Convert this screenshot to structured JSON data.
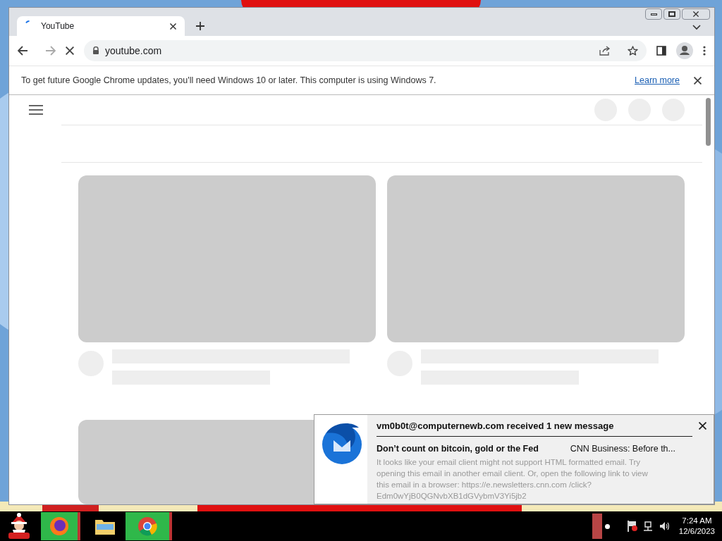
{
  "browser": {
    "tabs": [
      {
        "title": "YouTube",
        "selected": true
      }
    ],
    "address": "youtube.com",
    "infobar": {
      "message": "To get future Google Chrome updates, you'll need Windows 10 or later. This computer is using Windows 7.",
      "link": "Learn more"
    }
  },
  "notification": {
    "title": "vm0b0t@computernewb.com received 1 new message",
    "subject": "Don’t count on bitcoin, gold or the Fed",
    "sender": "CNN Business: Before th...",
    "body": "It looks like your email client might not support HTML formatted email. Try opening this email in another email client. Or, open the following link to view this email in a browser: https://e.newsletters.cnn.com /click?Edm0wYjB0QGNvbXB1dGVybmV3Yi5jb2"
  },
  "taskbar": {
    "time": "7:24 AM",
    "date": "12/6/2023"
  }
}
